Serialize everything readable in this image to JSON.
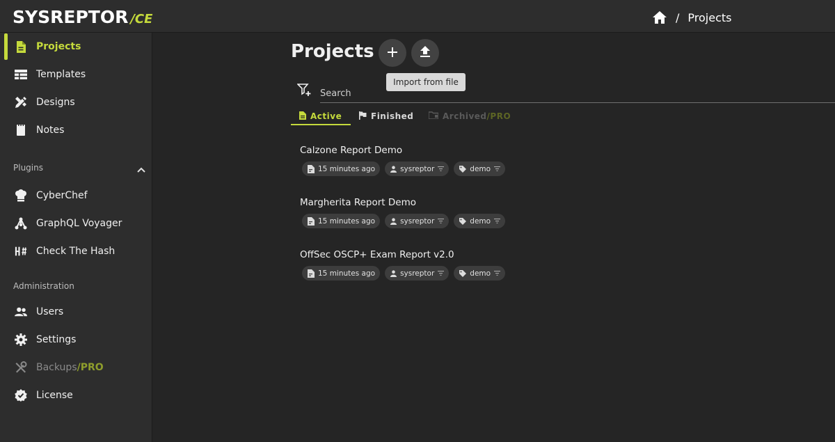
{
  "app": {
    "logo_text": "SYSREPTOR",
    "logo_edition": "/CE"
  },
  "breadcrumb": {
    "separator": "/",
    "current": "Projects"
  },
  "sidebar": {
    "items": [
      {
        "label": "Projects",
        "icon": "document-icon",
        "active": true
      },
      {
        "label": "Templates",
        "icon": "table-icon"
      },
      {
        "label": "Designs",
        "icon": "pencil-ruler-icon"
      },
      {
        "label": "Notes",
        "icon": "notebook-icon"
      }
    ],
    "plugins_label": "Plugins",
    "plugins": [
      {
        "label": "CyberChef",
        "icon": "chef-hat-icon"
      },
      {
        "label": "GraphQL Voyager",
        "icon": "graph-icon"
      },
      {
        "label": "Check The Hash",
        "icon": "hash-icon"
      }
    ],
    "admin_label": "Administration",
    "admin": [
      {
        "label": "Users",
        "icon": "users-icon"
      },
      {
        "label": "Settings",
        "icon": "gear-icon"
      },
      {
        "label": "Backups",
        "pro": "/PRO",
        "icon": "tools-icon",
        "disabled": true
      },
      {
        "label": "License",
        "icon": "verified-badge-icon"
      }
    ]
  },
  "main": {
    "title": "Projects",
    "add_button_icon": "plus-icon",
    "import_button_icon": "upload-icon",
    "tooltip": "Import from file",
    "search_placeholder": "Search",
    "tabs": [
      {
        "label": "Active",
        "icon": "document-icon",
        "active": true
      },
      {
        "label": "Finished",
        "icon": "flag-icon"
      },
      {
        "label": "Archived",
        "pro": "/PRO",
        "icon": "archive-folder-icon",
        "disabled": true
      }
    ],
    "projects": [
      {
        "name": "Calzone Report Demo",
        "time": "15 minutes ago",
        "user": "sysreptor",
        "tag": "demo"
      },
      {
        "name": "Margherita Report Demo",
        "time": "15 minutes ago",
        "user": "sysreptor",
        "tag": "demo"
      },
      {
        "name": "OffSec OSCP+ Exam Report v2.0",
        "time": "15 minutes ago",
        "user": "sysreptor",
        "tag": "demo"
      }
    ]
  },
  "colors": {
    "accent": "#c5da3c",
    "background": "#252525",
    "sidebar": "#2d2d2d"
  }
}
